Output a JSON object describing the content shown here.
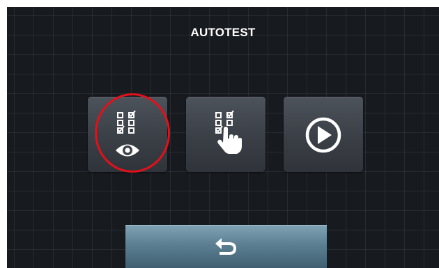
{
  "screen": {
    "title": "AUTOTEST"
  },
  "buttons": [
    {
      "icon": "checklist-view-icon"
    },
    {
      "icon": "checklist-manual-icon"
    },
    {
      "icon": "play-icon"
    }
  ],
  "footer": {
    "back_icon": "back-arrow-icon"
  },
  "colors": {
    "background": "#171a1f",
    "tile": "#3e434a",
    "highlight": "#e3101b",
    "back_button": "#5b7f91"
  }
}
